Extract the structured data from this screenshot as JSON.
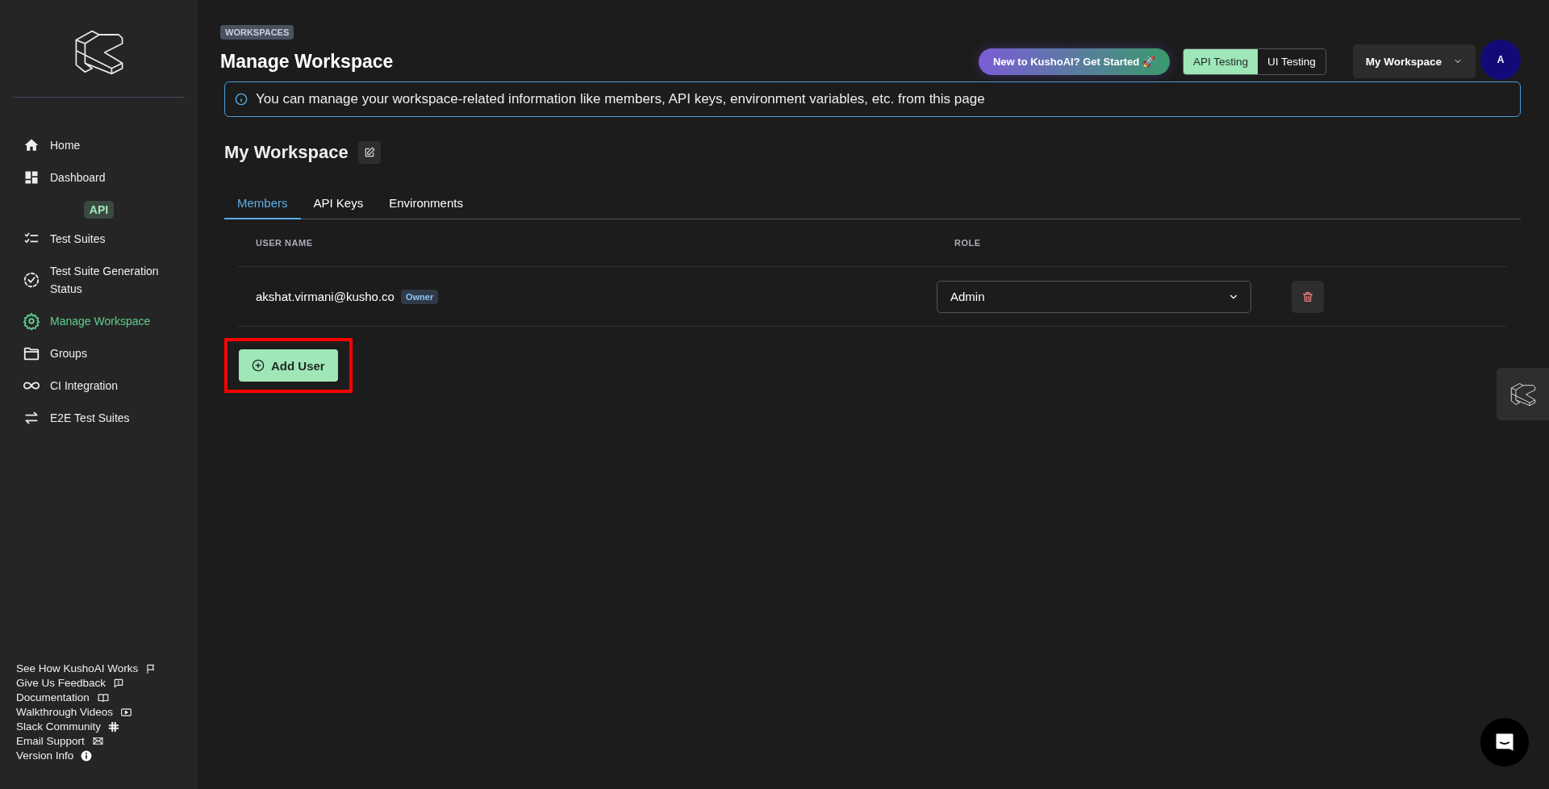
{
  "sidebar": {
    "items": [
      {
        "label": "Home",
        "selected": false
      },
      {
        "label": "Dashboard",
        "selected": false
      }
    ],
    "section": {
      "label": "API",
      "items": [
        {
          "label": "Test Suites",
          "selected": false
        },
        {
          "label": "Test Suite Generation Status",
          "selected": false
        },
        {
          "label": "Manage Workspace",
          "selected": true
        },
        {
          "label": "Groups",
          "selected": false
        },
        {
          "label": "CI Integration",
          "selected": false
        },
        {
          "label": "E2E Test Suites",
          "selected": false
        }
      ]
    },
    "links": [
      "See How KushoAI Works",
      "Give Us Feedback",
      "Documentation",
      "Walkthrough Videos",
      "Slack Community",
      "Email Support",
      "Version Info"
    ]
  },
  "header": {
    "breadcrumb": "WORKSPACES",
    "title": "Manage Workspace",
    "promo": "New to KushoAI? Get Started 🚀",
    "modes": [
      {
        "label": "API Testing",
        "selected": true
      },
      {
        "label": "UI Testing",
        "selected": false
      }
    ],
    "workspace": "My Workspace",
    "avatar": "A"
  },
  "info": "You can manage your workspace-related information like members, API keys, environment variables, etc. from this page",
  "workspace_name": "My Workspace",
  "tabs": [
    {
      "label": "Members",
      "selected": true
    },
    {
      "label": "API Keys",
      "selected": false
    },
    {
      "label": "Environments",
      "selected": false
    }
  ],
  "table": {
    "columns": [
      "USER NAME",
      "ROLE"
    ],
    "rows": [
      {
        "email": "akshat.virmani@kusho.co",
        "badge": "Owner",
        "role": "Admin"
      }
    ]
  },
  "add_user": {
    "label": "Add User",
    "highlighted": true
  }
}
